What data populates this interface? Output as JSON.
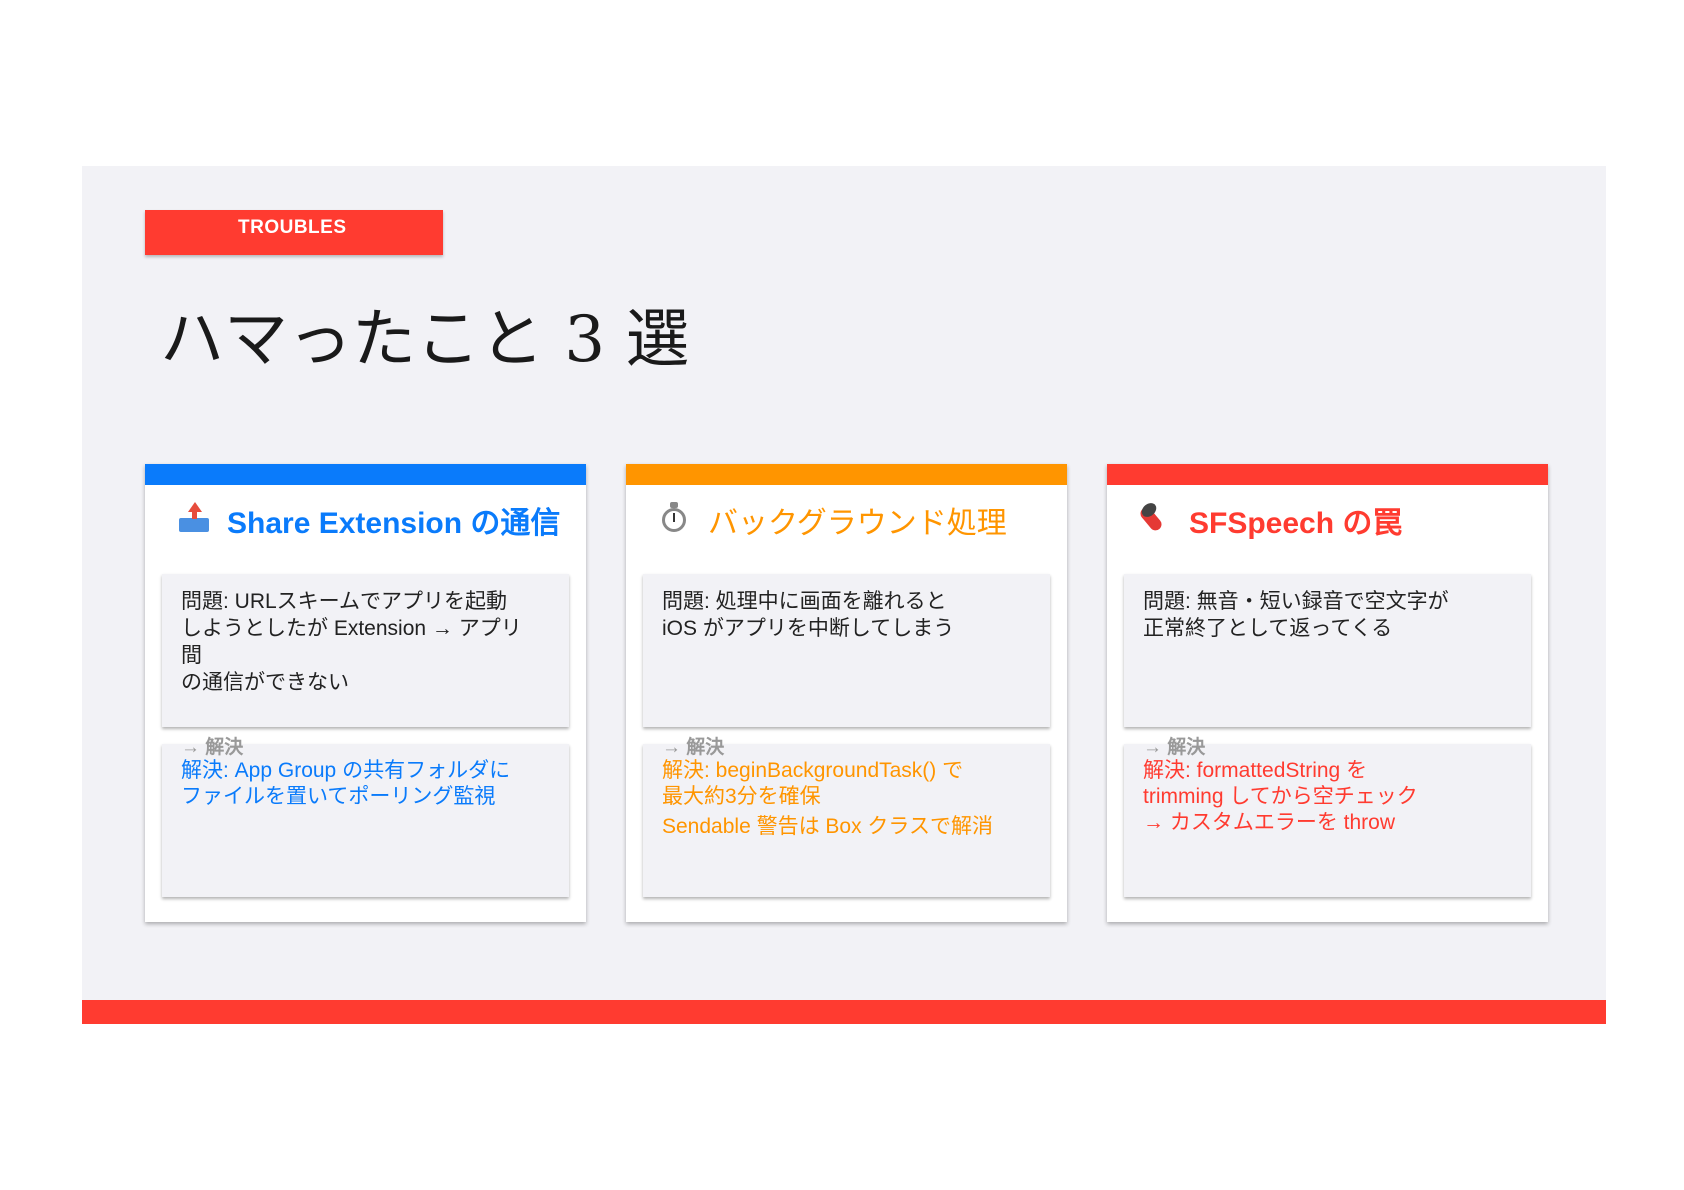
{
  "tag": "TROUBLES",
  "title": "ハマったこと 3 選",
  "colors": {
    "blue": "#0a7bfb",
    "orange": "#ff9500",
    "red": "#ff3b30",
    "background": "#f2f2f6"
  },
  "cards": [
    {
      "icon": "outbox-tray-icon",
      "heading": "Share Extension の通信",
      "problem": [
        "問題: URLスキームでアプリを起動",
        "しようとしたが Extension → アプリ",
        "間",
        "の通信ができない"
      ],
      "arrow_label": "→ 解決",
      "solution": [
        "解決: App Group の共有フォルダに",
        "ファイルを置いてポーリング監視"
      ],
      "solution_extra": ""
    },
    {
      "icon": "stopwatch-icon",
      "heading": "バックグラウンド処理",
      "problem": [
        "問題: 処理中に画面を離れると",
        "iOS がアプリを中断してしまう"
      ],
      "arrow_label": "→ 解決",
      "solution": [
        "解決: beginBackgroundTask() で",
        "最大約3分を確保"
      ],
      "solution_extra": "Sendable 警告は Box クラスで解消"
    },
    {
      "icon": "microphone-muted-icon",
      "heading": "SFSpeech の罠",
      "problem": [
        "問題: 無音・短い録音で空文字が",
        "正常終了として返ってくる"
      ],
      "arrow_label": "→ 解決",
      "solution": [
        "解決: formattedString を",
        "trimming してから空チェック",
        "→ カスタムエラーを throw"
      ],
      "solution_extra": ""
    }
  ]
}
